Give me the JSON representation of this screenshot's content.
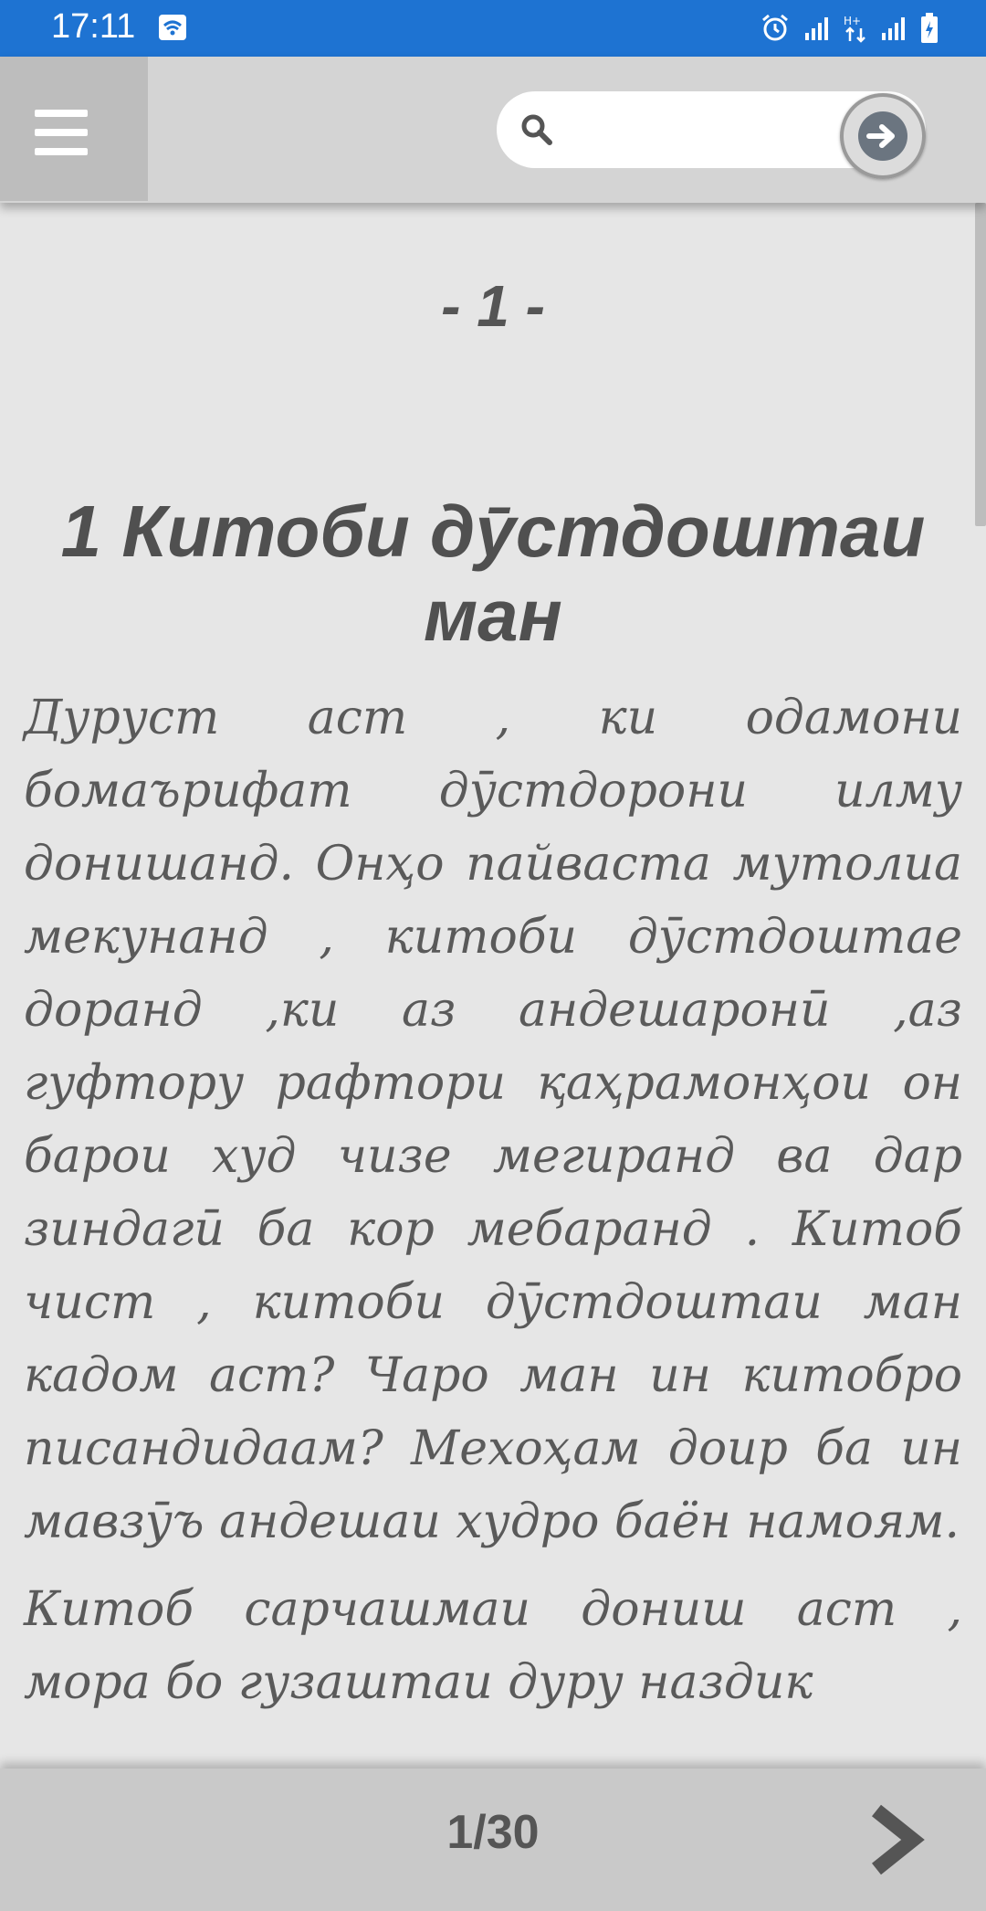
{
  "status_bar": {
    "time": "17:11",
    "color": "#1e73d2"
  },
  "toolbar": {
    "menu_icon": "hamburger-menu-icon",
    "search": {
      "icon": "search-icon",
      "value": "",
      "placeholder": ""
    },
    "go_icon": "arrow-right-circle-icon"
  },
  "reader": {
    "page_marker": "- 1 -",
    "chapter_title": "1 Китоби дӯстдоштаи ман",
    "paragraphs": [
      "Дуруст аст , ки одамони бомаърифат дӯстдорони илму донишанд. Онҳо пайваста мутолиа мекунанд , китоби дӯстдоштае доранд ,ки аз андешаронӣ ,аз гуфтору рафтори қаҳрамонҳои он барои худ чизе мегиранд ва дар зиндагӣ ба кор мебаранд . Китоб чист , китоби дӯстдоштаи ман кадом аст? Чаро ман ин китобро писандидаам? Мехоҳам доир ба ин мавзӯъ андешаи худро баён намоям.",
      "Китоб сарчашмаи дониш аст , мора бо гузаштаи дуру наздик"
    ]
  },
  "pager": {
    "label": "1/30",
    "current": 1,
    "total": 30,
    "next_icon": "chevron-right-icon"
  }
}
